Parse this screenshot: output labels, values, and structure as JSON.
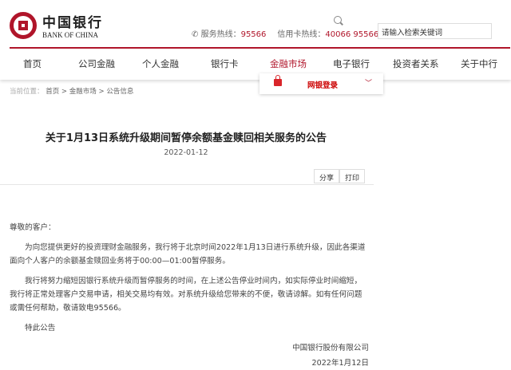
{
  "header": {
    "logo_cn": "中国银行",
    "logo_en": "BANK OF CHINA",
    "service_label": "服务热线：",
    "service_number": "95566",
    "card_label": "信用卡热线：",
    "card_number": "40066 95566",
    "search_placeholder": "请输入检索关键词"
  },
  "nav": [
    "首页",
    "公司金融",
    "个人金融",
    "银行卡",
    "金融市场",
    "电子银行",
    "投资者关系",
    "关于中行"
  ],
  "dropdown": {
    "label": "网银登录"
  },
  "breadcrumb": {
    "prefix": "当前位置：",
    "items": [
      "首页",
      "金融市场",
      "公告信息"
    ]
  },
  "article": {
    "title": "关于1月13日系统升级期间暂停余额基金赎回相关服务的公告",
    "date": "2022-01-12",
    "share": "分享",
    "print": "打印",
    "greeting": "尊敬的客户：",
    "p1": "为向您提供更好的投资理财金融服务，我行将于北京时间2022年1月13日进行系统升级，因此各渠道面向个人客户的余额基金赎回业务将于00:00—01:00暂停服务。",
    "p2": "我行将努力缩短因银行系统升级而暂停服务的时间，在上述公告停业时间内，如实际停业时间缩短，我行将正常处理客户交易申请，相关交易均有效。对系统升级给您带来的不便，敬请谅解。如有任何问题或需任何帮助，敬请致电95566。",
    "p3": "特此公告",
    "company": "中国银行股份有限公司",
    "sign_date": "2022年1月12日"
  }
}
